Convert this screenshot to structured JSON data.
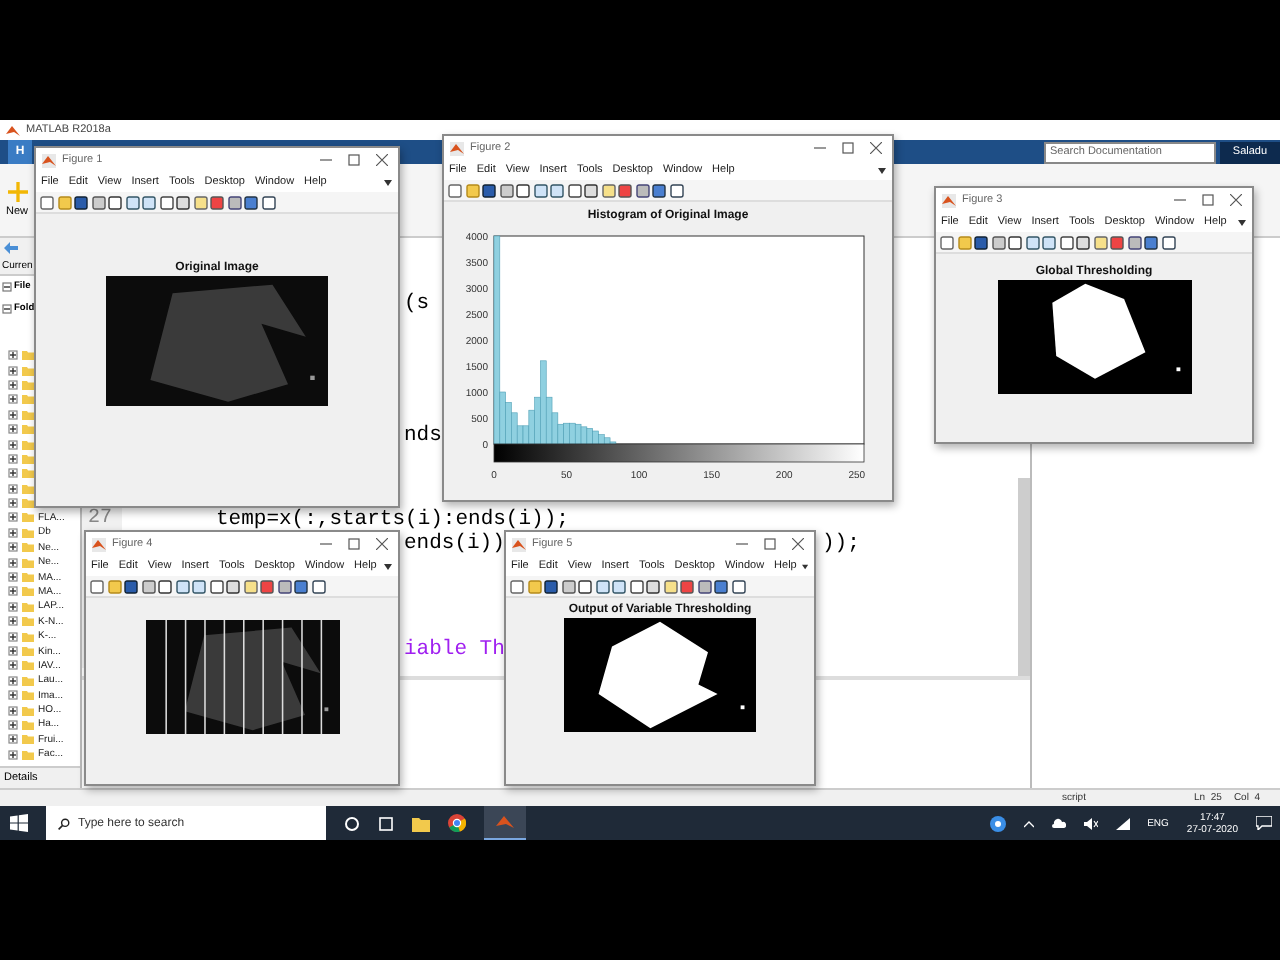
{
  "matlab": {
    "title": "MATLAB R2018a",
    "tab": {
      "label": "H",
      "selected": true
    },
    "search": {
      "placeholder": "Search Documentation"
    },
    "user_button": "Saladu",
    "ribbon": {
      "new_label": "New"
    },
    "folder_panel": {
      "header": "Curren",
      "sections": [
        {
          "label": "File",
          "expanded": true
        },
        {
          "label": "Fold",
          "expanded": true
        }
      ],
      "items": [
        {
          "expanded": false
        },
        {
          "expanded": false
        },
        {
          "expanded": false
        },
        {
          "expanded": false
        },
        {
          "expanded": false
        },
        {
          "expanded": false
        },
        {
          "expanded": false
        },
        {
          "expanded": false
        },
        {
          "expanded": false
        },
        {
          "expanded": false
        },
        {
          "expanded": false
        },
        {
          "name": "FLA...",
          "expanded": false
        },
        {
          "name": "Db",
          "expanded": false
        },
        {
          "name": "Ne...",
          "expanded": false
        },
        {
          "name": "Ne...",
          "expanded": false
        },
        {
          "name": "MA...",
          "expanded": false
        },
        {
          "name": "MA...",
          "expanded": false
        },
        {
          "name": "LAP...",
          "expanded": false
        },
        {
          "name": "K-N...",
          "expanded": false
        },
        {
          "name": "K-...",
          "expanded": false
        },
        {
          "name": "Kin...",
          "expanded": false
        },
        {
          "name": "IAV...",
          "expanded": false
        },
        {
          "name": "Lau...",
          "expanded": false
        },
        {
          "name": "Ima...",
          "expanded": false
        },
        {
          "name": "HO...",
          "expanded": false
        },
        {
          "name": "Ha...",
          "expanded": false
        },
        {
          "name": "Frui...",
          "expanded": false
        },
        {
          "name": "Fac...",
          "expanded": false
        }
      ],
      "details": "Details"
    },
    "editor": {
      "line_number": "27",
      "fragments": [
        {
          "text": "(s",
          "kind": "code"
        },
        {
          "text": "nds",
          "kind": "code"
        },
        {
          "text": "temp=x(:,starts(i):ends(i));",
          "kind": "code"
        },
        {
          "text": "ends(i))",
          "kind": "code"
        },
        {
          "text": "));",
          "kind": "code"
        },
        {
          "text": "iable Th",
          "kind": "string"
        }
      ]
    },
    "status_bar": {
      "mode": "script",
      "line": "Ln  25",
      "column": "Col  4"
    }
  },
  "figures": [
    {
      "title": "Figure 1",
      "menu": [
        "File",
        "Edit",
        "View",
        "Insert",
        "Tools",
        "Desktop",
        "Window",
        "Help"
      ],
      "kind": "image",
      "image": {
        "binary": false,
        "split_lines": false
      },
      "axes_title": "Original Image"
    },
    {
      "title": "Figure 2",
      "menu": [
        "File",
        "Edit",
        "View",
        "Insert",
        "Tools",
        "Desktop",
        "Window",
        "Help"
      ],
      "kind": "chart",
      "chart_data": {
        "type": "bar",
        "title": "Histogram of Original Image",
        "x": [
          2,
          6,
          10,
          14,
          18,
          22,
          26,
          30,
          34,
          38,
          42,
          46,
          50,
          54,
          58,
          62,
          66,
          70,
          74,
          78,
          82
        ],
        "values": [
          4000,
          1000,
          800,
          600,
          350,
          350,
          650,
          900,
          1600,
          900,
          600,
          380,
          400,
          400,
          380,
          330,
          300,
          250,
          180,
          120,
          40
        ],
        "xlim": [
          0,
          255
        ],
        "ylim": [
          0,
          4000
        ],
        "xticks": [
          0,
          50,
          100,
          150,
          200,
          250
        ],
        "yticks": [
          0,
          500,
          1000,
          1500,
          2000,
          2500,
          3000,
          3500,
          4000
        ]
      }
    },
    {
      "title": "Figure 3",
      "menu": [
        "File",
        "Edit",
        "View",
        "Insert",
        "Tools",
        "Desktop",
        "Window",
        "Help"
      ],
      "kind": "image",
      "image": {
        "binary": true,
        "split_lines": false
      },
      "axes_title": "Global Thresholding"
    },
    {
      "title": "Figure 4",
      "menu": [
        "File",
        "Edit",
        "View",
        "Insert",
        "Tools",
        "Desktop",
        "Window",
        "Help"
      ],
      "kind": "image",
      "image": {
        "binary": false,
        "split_lines": true
      }
    },
    {
      "title": "Figure 5",
      "menu": [
        "File",
        "Edit",
        "View",
        "Insert",
        "Tools",
        "Desktop",
        "Window",
        "Help"
      ],
      "kind": "image",
      "image": {
        "binary": true,
        "split_lines": false
      },
      "axes_title": "Output of Variable Thresholding"
    }
  ],
  "taskbar": {
    "search": {
      "placeholder": "Type here to search"
    },
    "language": "ENG",
    "time": "17:47",
    "date": "27-07-2020"
  }
}
